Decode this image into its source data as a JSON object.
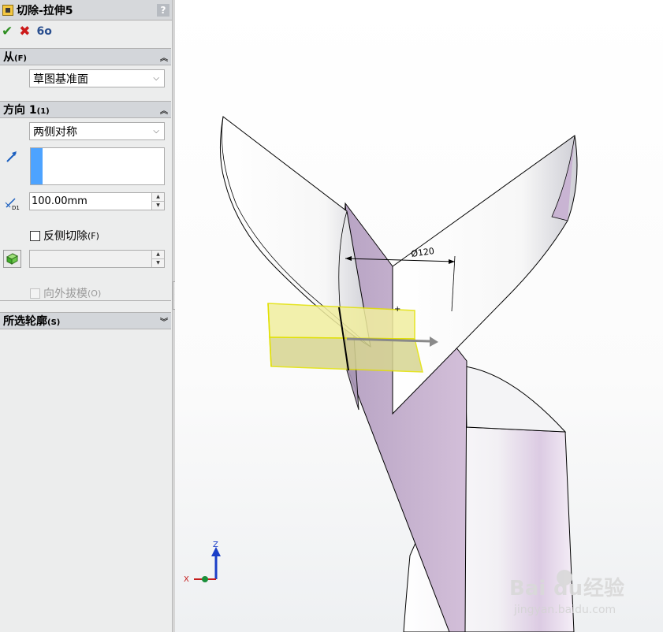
{
  "panel": {
    "title": "切除-拉伸5",
    "help": "?",
    "actions": {
      "ok": "✔",
      "cancel": "✖",
      "preview": "6o"
    },
    "from_group": {
      "title": "从",
      "shortcut": "(F)",
      "start_condition": "草图基准面"
    },
    "direction1_group": {
      "title": "方向 1",
      "shortcut": "(1)",
      "end_condition": "两侧对称",
      "depth_value": "100.00mm",
      "depth_icon_label": "D1",
      "flip_side_label": "反侧切除",
      "flip_side_shortcut": "(F)",
      "flip_side_checked": false,
      "draft_value": "",
      "draft_outward_label": "向外拔模",
      "draft_outward_shortcut": "(O)",
      "draft_outward_enabled": false
    },
    "contours_group": {
      "title": "所选轮廓",
      "shortcut": "(S)"
    }
  },
  "viewport": {
    "dimension_label": "Ø120",
    "triad": {
      "z": "Z",
      "x": "X"
    },
    "watermark": {
      "brand": "Bai",
      "brand_tail": "du",
      "brand_cn": "经验",
      "url": "jingyan.baidu.com"
    }
  },
  "colors": {
    "accent_blue": "#4da3ff",
    "preview_fill": "#f3ef9a",
    "face_purple": "#c7b2cf",
    "ok_green": "#2f8f22",
    "cancel_red": "#cc1a1a"
  }
}
